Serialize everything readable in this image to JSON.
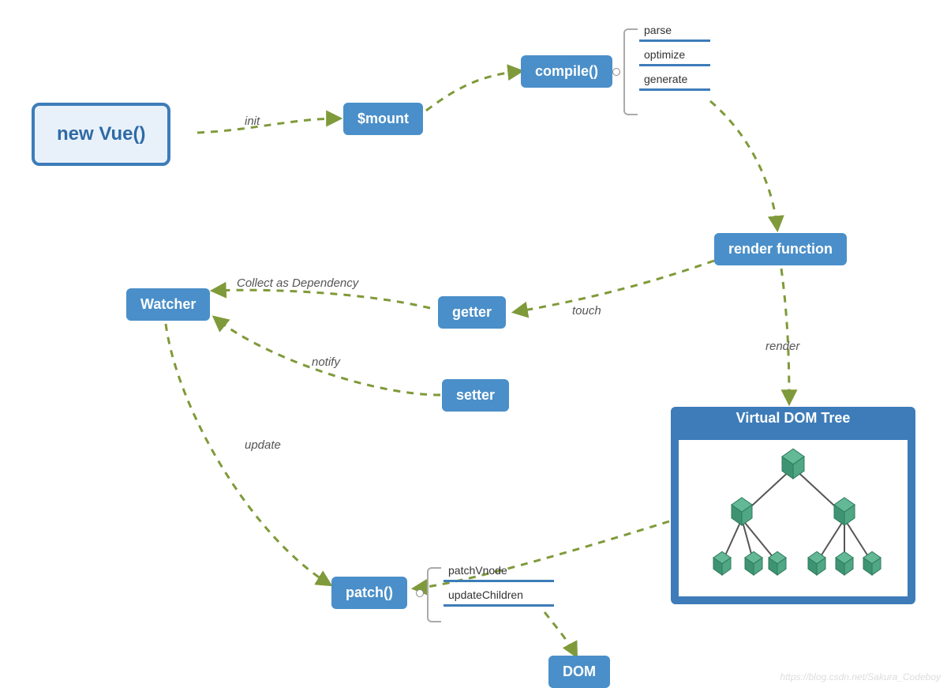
{
  "nodes": {
    "newVue": {
      "label": "new Vue()"
    },
    "mount": {
      "label": "$mount"
    },
    "compile": {
      "label": "compile()"
    },
    "renderFn": {
      "label": "render function"
    },
    "watcher": {
      "label": "Watcher"
    },
    "getter": {
      "label": "getter"
    },
    "setter": {
      "label": "setter"
    },
    "patch": {
      "label": "patch()"
    },
    "dom": {
      "label": "DOM"
    },
    "vdom": {
      "label": "Virtual DOM Tree"
    }
  },
  "annotations": {
    "compile": [
      "parse",
      "optimize",
      "generate"
    ],
    "patch": [
      "patchVnode",
      "updateChildren"
    ]
  },
  "edges": {
    "init": "init",
    "touch": "touch",
    "collect": "Collect as Dependency",
    "notify": "notify",
    "render": "render",
    "update": "update"
  },
  "watermark": "https://blog.csdn.net/Sakura_Codeboy"
}
